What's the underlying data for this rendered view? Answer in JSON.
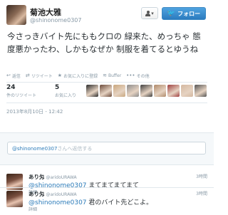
{
  "tweet": {
    "display_name": "菊池大雅",
    "screen_name": "@shinonome0307",
    "text": "今さっきバイト先にももクロの 緑来た、めっちゃ 態度悪かったわ、しかもなぜか 制服を着てるとゆうね",
    "timestamp": "2013年8月10日 - 12:42"
  },
  "header": {
    "dropdown_caret": "▾",
    "follow_label": "フォロー",
    "bird_glyph": "🐦"
  },
  "actions": [
    {
      "icon": "reply-icon",
      "glyph": "↩",
      "label": "返信"
    },
    {
      "icon": "retweet-icon",
      "glyph": "⇄",
      "label": "リツイート"
    },
    {
      "icon": "star-icon",
      "glyph": "★",
      "label": "お気に入りに登録"
    },
    {
      "icon": "buffer-icon",
      "glyph": "≋",
      "label": "Buffer"
    },
    {
      "icon": "more-icon",
      "glyph": "•••",
      "label": "その他"
    }
  ],
  "stats": {
    "retweets": {
      "count": "24",
      "label": "件のリツイート"
    },
    "favorites": {
      "count": "5",
      "label": "お気に入り"
    }
  },
  "favoriter_colors": [
    "#2c2c2c",
    "#6b4a3a",
    "#c9a77e",
    "#8c8c8c",
    "#3f3f3f",
    "#b08a6a",
    "#a04040",
    "#d4b8a0",
    "#555555"
  ],
  "reply_box": {
    "mention": "@shinonome0307",
    "placeholder": "さんへ返信する"
  },
  "replies": [
    {
      "name": "あり匁",
      "handle": "@aridoURAWA",
      "time": "3時間",
      "mention": "@shinonome0307",
      "text": " まてまてまてまて",
      "details": "詳細"
    },
    {
      "name": "あり匁",
      "handle": "@aridoURAWA",
      "time": "3時間",
      "mention": "@shinonome0307",
      "text": " 君のバイト先どこよ。",
      "details": "詳細"
    }
  ]
}
